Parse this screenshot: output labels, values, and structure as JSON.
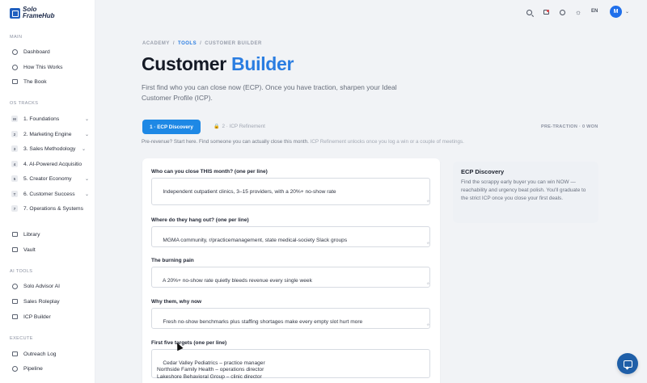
{
  "brand": {
    "line1": "Solo",
    "line2": "FrameHub"
  },
  "sidebar": {
    "sections": {
      "main": "MAIN",
      "os_tracks": "OS TRACKS",
      "ai_tools": "AI TOOLS",
      "execute": "EXECUTE"
    },
    "main_items": [
      {
        "label": "Dashboard",
        "icon": "clock-icon"
      },
      {
        "label": "How This Works",
        "icon": "help-circle-icon"
      },
      {
        "label": "The Book",
        "icon": "book-icon"
      }
    ],
    "tracks": [
      {
        "badge": "M",
        "label": "1. Foundations"
      },
      {
        "badge": "2",
        "label": "2. Marketing Engine"
      },
      {
        "badge": "3",
        "label": "3. Sales Methodology"
      },
      {
        "badge": "4",
        "label": "4. AI-Powered Acquisitio"
      },
      {
        "badge": "5",
        "label": "5. Creator Economy"
      },
      {
        "badge": "T",
        "label": "6. Customer Success"
      },
      {
        "badge": "7",
        "label": "7. Operations & Systems"
      }
    ],
    "library_items": [
      {
        "label": "Library",
        "icon": "library-icon"
      },
      {
        "label": "Vault",
        "icon": "vault-icon"
      }
    ],
    "ai_items": [
      {
        "label": "Solo Advisor AI",
        "icon": "chat-icon"
      },
      {
        "label": "Sales Roleplay",
        "icon": "roleplay-icon"
      },
      {
        "label": "ICP Builder",
        "icon": "builder-icon"
      }
    ],
    "execute_items": [
      {
        "label": "Outreach Log",
        "icon": "log-icon"
      },
      {
        "label": "Pipeline",
        "icon": "pipeline-icon"
      }
    ]
  },
  "topbar": {
    "lang": "EN",
    "avatar_initial": "M"
  },
  "breadcrumb": {
    "root": "ACADEMY",
    "sep": "/",
    "mid": "TOOLS",
    "current": "CUSTOMER BUILDER"
  },
  "title": {
    "main": "Customer",
    "accent": "Builder"
  },
  "intro": "First find who you can close now (ECP). Once you have traction, sharpen your Ideal Customer Profile (ICP).",
  "tabs": {
    "active": "1 · ECP Discovery",
    "locked": "2 · ICP Refinement"
  },
  "progress_tag": "PRE-TRACTION · 0 WON",
  "hint": {
    "main": "Pre-revenue? Start here. Find someone you can actually close this month.",
    "muted": "ICP Refinement unlocks once you log a win or a couple of meetings."
  },
  "form": {
    "fields": [
      {
        "label": "Who can you close THIS month? (one per line)",
        "value": "Independent outpatient clinics, 3–15 providers, with a 20%+ no-show rate"
      },
      {
        "label": "Where do they hang out? (one per line)",
        "value": "MGMA community, r/practicemanagement, state medical-society Slack groups"
      },
      {
        "label": "The burning pain",
        "value": "A 20%+ no-show rate quietly bleeds revenue every single week"
      },
      {
        "label": "Why them, why now",
        "value": "Fresh no-show benchmarks plus staffing shortages make every empty slot hurt more"
      },
      {
        "label": "First five targets (one per line)",
        "value": "Cedar Valley Pediatrics – practice manager\nNorthside Family Health – operations director\nLakeshore Behavioral Group – clinic director"
      }
    ]
  },
  "side_panel": {
    "title": "ECP Discovery",
    "body": "Find the scrappy early buyer you can win NOW — reachability and urgency beat polish. You'll graduate to the strict ICP once you close your first deals."
  },
  "colors": {
    "accent": "#2a7de1",
    "tab_active": "#1e88e5",
    "chat": "#1f5fa8"
  }
}
